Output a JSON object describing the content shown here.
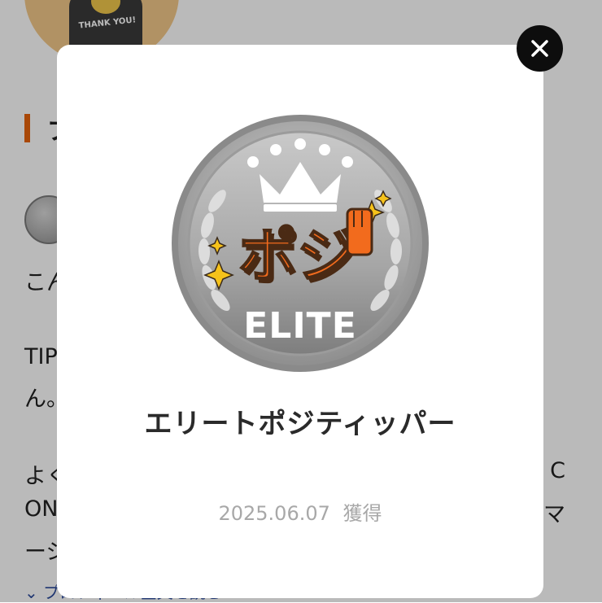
{
  "background": {
    "avatar_text": "THANK YOU!",
    "section_title": "プ",
    "badge_small_text": "ELITE",
    "lines_left": [
      "こん",
      "TIP",
      "ん。",
      "よく",
      "ON",
      "ージ"
    ],
    "lines_right": [
      "C",
      "マ"
    ],
    "more_link": "プロフィール全文を読む"
  },
  "modal": {
    "badge": {
      "logo_text": "ポジ",
      "tier_text": "ELITE"
    },
    "badge_name": "エリートポジティッパー",
    "acquired_date": "2025.06.07",
    "acquired_label": "獲得"
  },
  "icons": {
    "close": "close-icon",
    "chevron": "chevron-down-icon"
  },
  "colors": {
    "accent_orange": "#e8630a",
    "badge_silver": "#a9a9a9",
    "logo_orange": "#f26b1d",
    "close_button": "#0d0d0d"
  }
}
